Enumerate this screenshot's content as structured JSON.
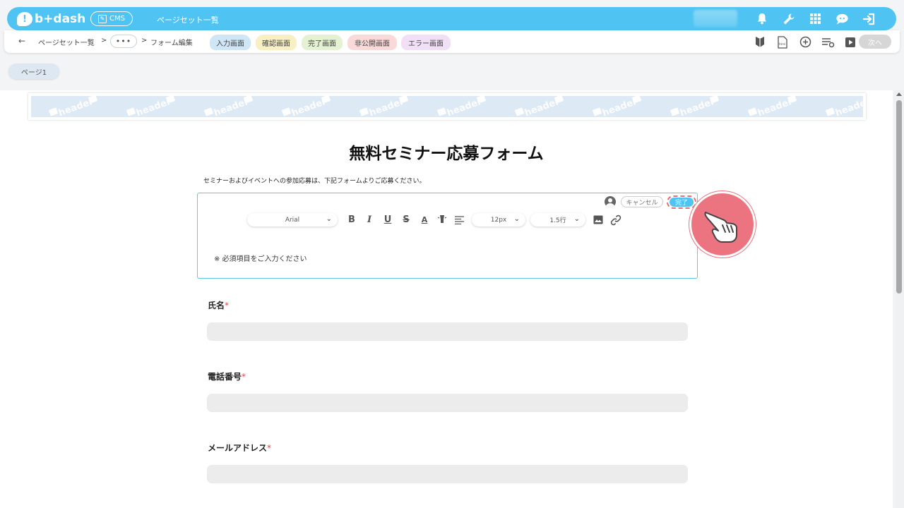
{
  "header": {
    "logo_text": "b+dash",
    "cms_label": "CMS",
    "title": "ページセット一覧",
    "icons": [
      "bell-icon",
      "wrench-icon",
      "grid-icon",
      "support-icon",
      "logout-icon"
    ]
  },
  "breadcrumb": {
    "back": "←",
    "item1": "ページセット一覧",
    "sep1": ">",
    "more": "•••",
    "sep2": ">",
    "item2": "フォーム編集"
  },
  "tabs": [
    {
      "label": "入力画面",
      "bg": "#cfe6f7"
    },
    {
      "label": "確認画面",
      "bg": "#f8efc4"
    },
    {
      "label": "完了画面",
      "bg": "#e4f1d3"
    },
    {
      "label": "非公開画面",
      "bg": "#fad9d9"
    },
    {
      "label": "エラー画面",
      "bg": "#f0dff5"
    }
  ],
  "nav_right": {
    "icons": [
      "beginner-icon",
      "html-file-icon",
      "add-circle-icon",
      "settings-list-icon",
      "video-icon"
    ],
    "next_label": "次へ"
  },
  "page_pill": "ページ1",
  "header_band_word": "header",
  "form": {
    "title": "無料セミナー応募フォーム",
    "description": "セミナーおよびイベントへの参加応募は、下記フォームよりご応募ください。"
  },
  "editor": {
    "cancel_label": "キャンセル",
    "done_label": "完了",
    "font_family": "Arial",
    "font_size": "12px",
    "line_height": "1.5行",
    "text": "※ 必須項目をご入力ください",
    "tools": [
      "bold-icon",
      "italic-icon",
      "underline-icon",
      "strikethrough-icon",
      "font-color-icon",
      "highlight-icon",
      "align-icon",
      "image-icon",
      "link-icon"
    ]
  },
  "fields": [
    {
      "label": "氏名",
      "required": "*"
    },
    {
      "label": "電話番号",
      "required": "*"
    },
    {
      "label": "メールアドレス",
      "required": "*"
    }
  ],
  "colors": {
    "brand": "#4fc4f2",
    "accent_pointer": "#ec7480",
    "required": "#e0424c"
  }
}
